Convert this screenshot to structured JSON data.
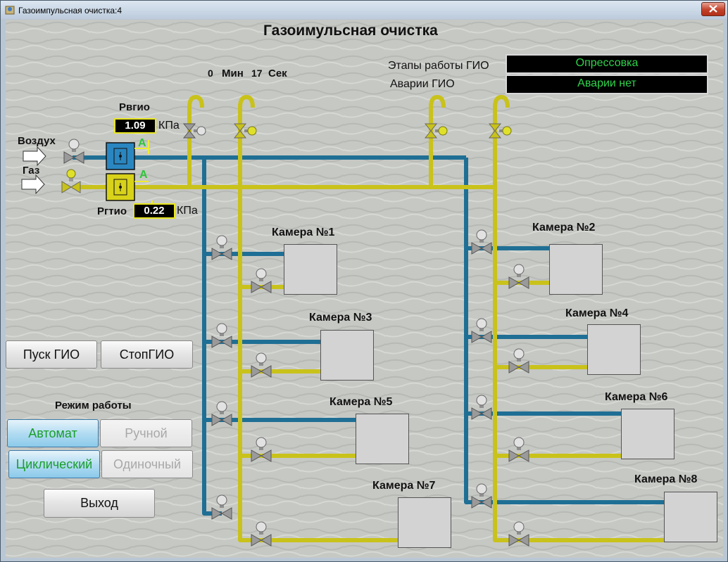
{
  "window": {
    "title": "Газоимпульсная очистка:4"
  },
  "header": {
    "title": "Газоимульсная очистка"
  },
  "timer": {
    "minutes": "0",
    "min_label": "Мин",
    "seconds": "17",
    "sec_label": "Сек"
  },
  "status": {
    "stage_label": "Этапы работы ГИО",
    "stage_value": "Опрессовка",
    "alarm_label": "Аварии ГИО",
    "alarm_value": "Аварии нет"
  },
  "inputs": {
    "air_label": "Воздух",
    "gas_label": "Газ"
  },
  "pressures": {
    "air": {
      "label": "Рвгио",
      "value": "1.09",
      "unit": "КПа",
      "indicator": "А"
    },
    "gas": {
      "label": "Ргтио",
      "value": "0.22",
      "unit": "КПа",
      "indicator": "А"
    }
  },
  "chambers": [
    {
      "label": "Камера №1"
    },
    {
      "label": "Камера №2"
    },
    {
      "label": "Камера №3"
    },
    {
      "label": "Камера №4"
    },
    {
      "label": "Камера №5"
    },
    {
      "label": "Камера №6"
    },
    {
      "label": "Камера №7"
    },
    {
      "label": "Камера №8"
    }
  ],
  "controls": {
    "start_label": "Пуск ГИО",
    "stop_label": "СтопГИО",
    "mode_title": "Режим работы",
    "auto_label": "Автомат",
    "manual_label": "Ручной",
    "cyclic_label": "Циклический",
    "single_label": "Одиночный",
    "exit_label": "Выход"
  },
  "colors": {
    "air_pipe": "#1f6f95",
    "gas_pipe": "#c9c21a",
    "active_text": "#1a9e2b",
    "display_text": "#2fd24b"
  }
}
